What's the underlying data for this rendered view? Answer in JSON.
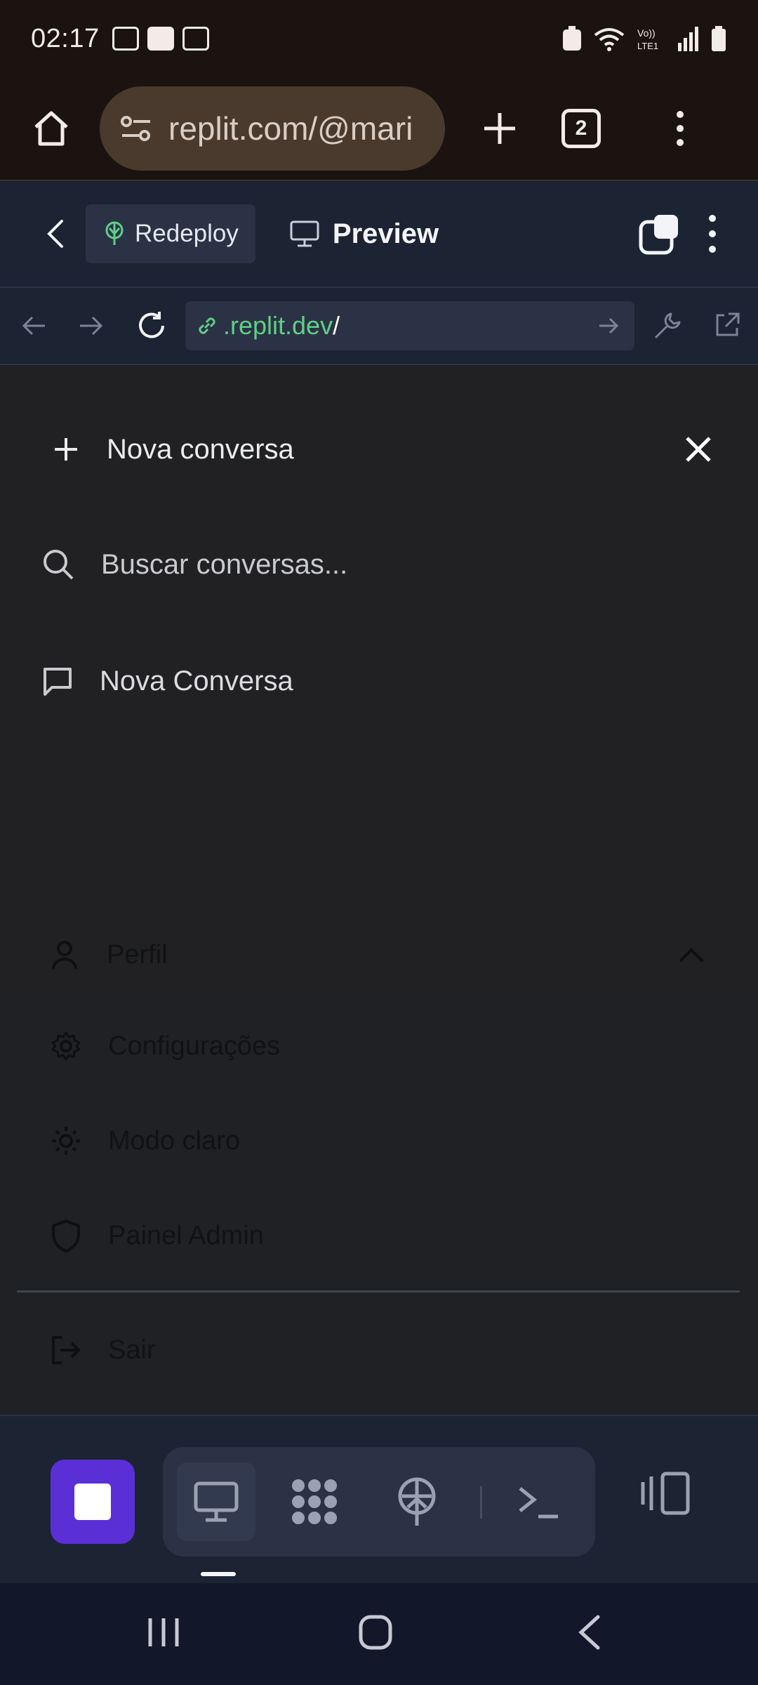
{
  "status_bar": {
    "time": "02:17"
  },
  "browser": {
    "url": "replit.com/@mari",
    "tab_count": "2"
  },
  "replit_header": {
    "redeploy_label": "Redeploy",
    "preview_label": "Preview"
  },
  "webview": {
    "url_host": ".replit.dev",
    "url_path": "/"
  },
  "sidebar": {
    "new_chat_label": "Nova conversa",
    "search_placeholder": "Buscar conversas...",
    "conversations": [
      {
        "title": "Nova Conversa"
      }
    ]
  },
  "profile_menu": {
    "header_label": "Perfil",
    "items": [
      {
        "label": "Configurações",
        "icon": "gear-icon"
      },
      {
        "label": "Modo claro",
        "icon": "sun-icon"
      },
      {
        "label": "Painel Admin",
        "icon": "shield-icon"
      }
    ],
    "logout_label": "Sair"
  },
  "colors": {
    "accent": "#5b2fd6",
    "link_green": "#5fcf86",
    "panel": "#212124",
    "replit_bg": "#1c2333"
  }
}
